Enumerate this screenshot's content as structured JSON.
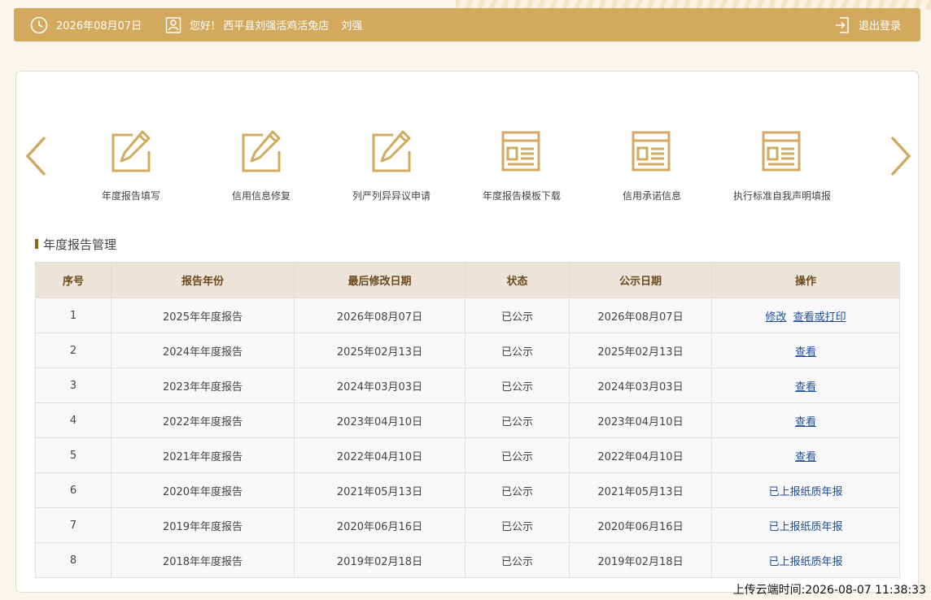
{
  "topbar": {
    "date": "2026年08月07日",
    "greeting": "您好!",
    "company": "西平县刘强活鸡活兔店",
    "user": "刘强",
    "logout": "退出登录"
  },
  "menu": [
    {
      "label": "年度报告填写",
      "icon": "edit-icon"
    },
    {
      "label": "信用信息修复",
      "icon": "edit-icon"
    },
    {
      "label": "列严列异异议申请",
      "icon": "edit-icon"
    },
    {
      "label": "年度报告模板下载",
      "icon": "template-icon"
    },
    {
      "label": "信用承诺信息",
      "icon": "template-icon"
    },
    {
      "label": "执行标准自我声明填报",
      "icon": "template-icon"
    }
  ],
  "section_title": "年度报告管理",
  "table": {
    "headers": [
      "序号",
      "报告年份",
      "最后修改日期",
      "状态",
      "公示日期",
      "操作"
    ],
    "rows": [
      {
        "no": "1",
        "year": "2025年年度报告",
        "modified": "2026年08月07日",
        "status": "已公示",
        "public": "2026年08月07日",
        "actions": [
          "修改",
          "查看或打印"
        ]
      },
      {
        "no": "2",
        "year": "2024年年度报告",
        "modified": "2025年02月13日",
        "status": "已公示",
        "public": "2025年02月13日",
        "actions": [
          "查看"
        ]
      },
      {
        "no": "3",
        "year": "2023年年度报告",
        "modified": "2024年03月03日",
        "status": "已公示",
        "public": "2024年03月03日",
        "actions": [
          "查看"
        ]
      },
      {
        "no": "4",
        "year": "2022年年度报告",
        "modified": "2023年04月10日",
        "status": "已公示",
        "public": "2023年04月10日",
        "actions": [
          "查看"
        ]
      },
      {
        "no": "5",
        "year": "2021年年度报告",
        "modified": "2022年04月10日",
        "status": "已公示",
        "public": "2022年04月10日",
        "actions": [
          "查看"
        ]
      },
      {
        "no": "6",
        "year": "2020年年度报告",
        "modified": "2021年05月13日",
        "status": "已公示",
        "public": "2021年05月13日",
        "paper": "已上报纸质年报"
      },
      {
        "no": "7",
        "year": "2019年年度报告",
        "modified": "2020年06月16日",
        "status": "已公示",
        "public": "2020年06月16日",
        "paper": "已上报纸质年报"
      },
      {
        "no": "8",
        "year": "2018年年度报告",
        "modified": "2019年02月18日",
        "status": "已公示",
        "public": "2019年02月18日",
        "paper": "已上报纸质年报"
      }
    ]
  },
  "upload_time": "上传云端时间:2026-08-07 11:38:33",
  "colors": {
    "accent": "#d2a95d",
    "link": "#1f4e9b",
    "header_bg": "#ece4d8"
  }
}
